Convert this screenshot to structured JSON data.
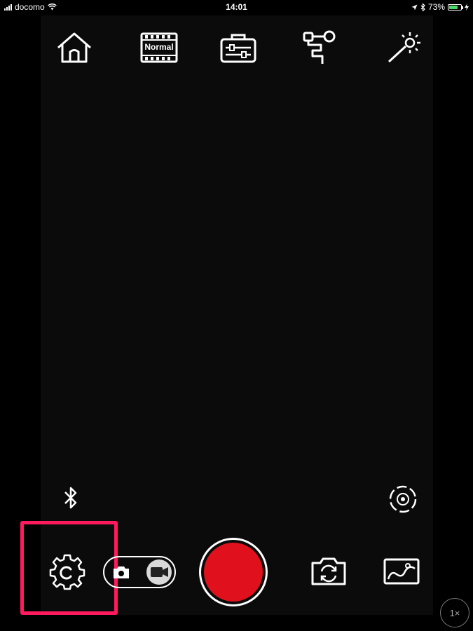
{
  "status_bar": {
    "carrier": "docomo",
    "time": "14:01",
    "battery_percent": "73%",
    "battery_level": 0.73,
    "battery_color": "#4cd964"
  },
  "toolbar": {
    "home_icon": "home-icon",
    "mode_label": "Normal",
    "toolbox_icon": "toolbox-icon",
    "gimbal_icon": "gimbal-icon",
    "effects_icon": "magic-wand-icon"
  },
  "controls": {
    "bluetooth_icon": "bluetooth-icon",
    "focus_icon": "focus-target-icon",
    "settings_icon": "gear-icon",
    "photo_mode_icon": "camera-icon",
    "video_mode_icon": "video-camera-icon",
    "active_mode": "video",
    "shutter_color": "#e0111c",
    "flip_camera_icon": "flip-camera-icon",
    "gallery_icon": "gallery-icon",
    "zoom_label": "1×",
    "highlight_color": "#ff1a5e"
  }
}
